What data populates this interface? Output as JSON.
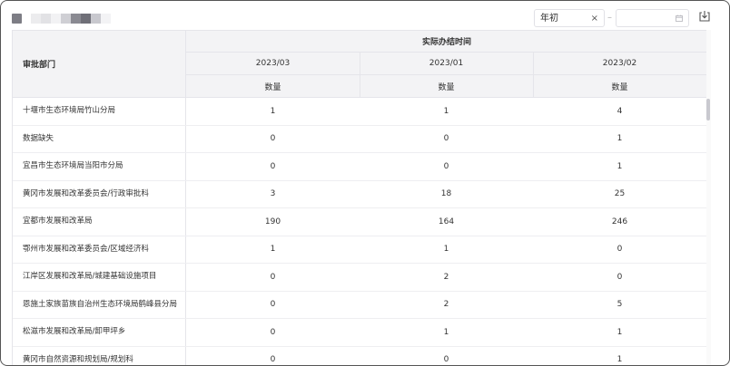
{
  "filters": {
    "start_value": "年初",
    "clear_symbol": "×",
    "separator": "–"
  },
  "table": {
    "dept_header": "审批部门",
    "group_header": "实际办结时间",
    "months": [
      "2023/03",
      "2023/01",
      "2023/02"
    ],
    "measure_label": "数量",
    "rows": [
      {
        "dept": "十堰市生态环境局竹山分局",
        "values": [
          "1",
          "1",
          "4"
        ]
      },
      {
        "dept": "数据缺失",
        "values": [
          "0",
          "0",
          "1"
        ]
      },
      {
        "dept": "宜昌市生态环境局当阳市分局",
        "values": [
          "0",
          "0",
          "1"
        ]
      },
      {
        "dept": "黄冈市发展和改革委员会/行政审批科",
        "values": [
          "3",
          "18",
          "25"
        ]
      },
      {
        "dept": "宜都市发展和改革局",
        "values": [
          "190",
          "164",
          "246"
        ]
      },
      {
        "dept": "鄂州市发展和改革委员会/区域经济科",
        "values": [
          "1",
          "1",
          "0"
        ]
      },
      {
        "dept": "江岸区发展和改革局/城建基础设施项目",
        "values": [
          "0",
          "2",
          "0"
        ]
      },
      {
        "dept": "恩施土家族苗族自治州生态环境局鹤峰县分局",
        "values": [
          "0",
          "2",
          "5"
        ]
      },
      {
        "dept": "松滋市发展和改革局/卸甲坪乡",
        "values": [
          "0",
          "1",
          "1"
        ]
      },
      {
        "dept": "黄冈市自然资源和规划局/规划科",
        "values": [
          "0",
          "0",
          "1"
        ]
      }
    ]
  },
  "colors": {
    "header_bg": "#f3f3f5",
    "border": "#e5e5ea"
  }
}
